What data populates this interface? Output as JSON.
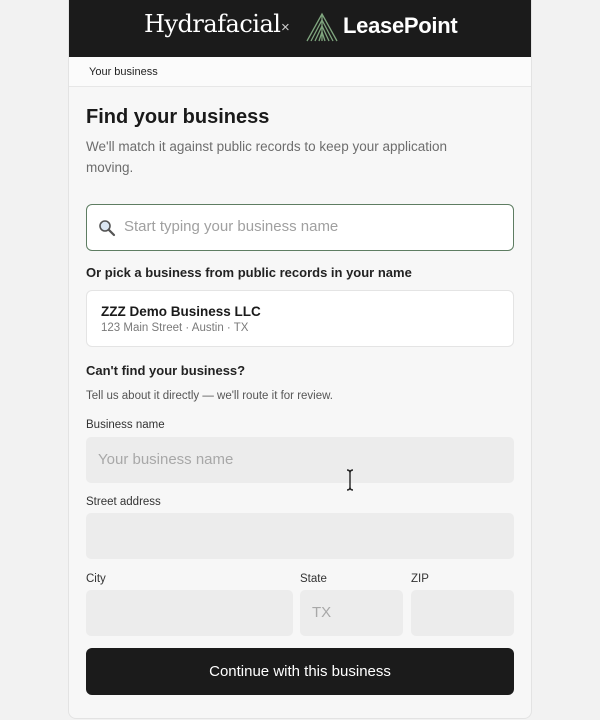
{
  "header": {
    "brand_left": "Hydrafacial",
    "separator": "×",
    "brand_right": "LeasePoint"
  },
  "breadcrumb": {
    "label": "Your business"
  },
  "main": {
    "title": "Find your business",
    "subtitle": "We'll match it against public records to keep your application moving.",
    "search": {
      "placeholder": "Start typing your business name",
      "icon": "search-icon"
    },
    "pick_label": "Or pick a business from public records in your name",
    "suggestions": [
      {
        "name": "ZZZ Demo Business LLC",
        "address": "123 Main Street · Austin · TX"
      }
    ],
    "manual": {
      "heading": "Can't find your business?",
      "subheading": "Tell us about it directly — we'll route it for review.",
      "business_name_label": "Business name",
      "business_name_placeholder": "Your business name",
      "street_label": "Street address",
      "street_placeholder": "",
      "city_label": "City",
      "city_placeholder": "",
      "state_label": "State",
      "state_placeholder": "TX",
      "zip_label": "ZIP",
      "zip_placeholder": ""
    },
    "continue_label": "Continue with this business"
  },
  "colors": {
    "header_bg": "#1b1b1b",
    "search_border": "#5e7d62",
    "leaf_green": "#7fa57e",
    "button_bg": "#1b1b1b"
  }
}
